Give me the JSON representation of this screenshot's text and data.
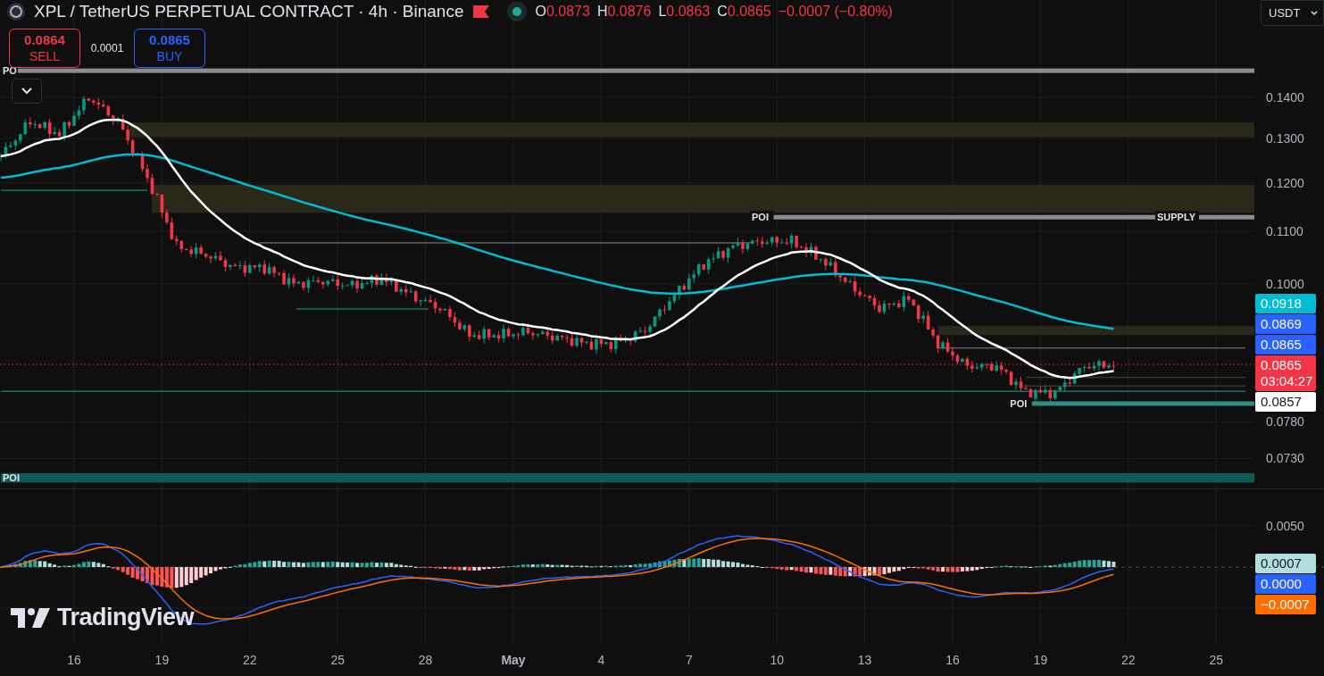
{
  "header": {
    "title": "XPL / TetherUS PERPETUAL CONTRACT · 4h · Binance",
    "ohlc": [
      {
        "label": "O",
        "value": "0.0873"
      },
      {
        "label": "H",
        "value": "0.0876"
      },
      {
        "label": "L",
        "value": "0.0863"
      },
      {
        "label": "C",
        "value": "0.0865"
      }
    ],
    "change": "−0.0007 (−0.80%)"
  },
  "trade": {
    "sell": {
      "price": "0.0864",
      "label": "SELL"
    },
    "spread": "0.0001",
    "buy": {
      "price": "0.0865",
      "label": "BUY"
    }
  },
  "currency": {
    "value": "USDT"
  },
  "price_chart": {
    "axis_labels": [
      "0.1400",
      "0.1300",
      "0.1200",
      "0.1100",
      "0.1000",
      "0.0780",
      "0.0730"
    ],
    "levels": [
      {
        "kind": "line",
        "label": "PO"
      },
      {
        "kind": "line",
        "label": "POI",
        "end_label": "SUPPLY"
      },
      {
        "kind": "line",
        "label": "POI"
      },
      {
        "kind": "band",
        "label": "POI"
      }
    ],
    "badges": [
      {
        "text": "0.0918",
        "color": "#00bcd4"
      },
      {
        "text": "0.0869",
        "color": "#2962ff"
      },
      {
        "text": "0.0865",
        "color": "#2962ff"
      },
      {
        "text": "0.0865",
        "sub": "03:04:27",
        "color": "#f23645"
      },
      {
        "text": "0.0857",
        "color": "#ffffff"
      }
    ]
  },
  "macd": {
    "axis_labels": [
      "0.0050"
    ],
    "badges": [
      {
        "text": "0.0007",
        "color": "#b2dfdb"
      },
      {
        "text": "0.0000",
        "color": "#2962ff"
      },
      {
        "text": "−0.0007",
        "color": "#ff6d00"
      }
    ]
  },
  "time_axis": [
    {
      "label": "16",
      "kind": "day"
    },
    {
      "label": "19",
      "kind": "day"
    },
    {
      "label": "22",
      "kind": "day"
    },
    {
      "label": "25",
      "kind": "day"
    },
    {
      "label": "28",
      "kind": "day"
    },
    {
      "label": "May",
      "kind": "month"
    },
    {
      "label": "4",
      "kind": "day"
    },
    {
      "label": "7",
      "kind": "day"
    },
    {
      "label": "10",
      "kind": "day"
    },
    {
      "label": "13",
      "kind": "day"
    },
    {
      "label": "16",
      "kind": "day"
    },
    {
      "label": "19",
      "kind": "day"
    },
    {
      "label": "22",
      "kind": "day"
    },
    {
      "label": "25",
      "kind": "day"
    }
  ],
  "brand": {
    "name": "TradingView"
  }
}
